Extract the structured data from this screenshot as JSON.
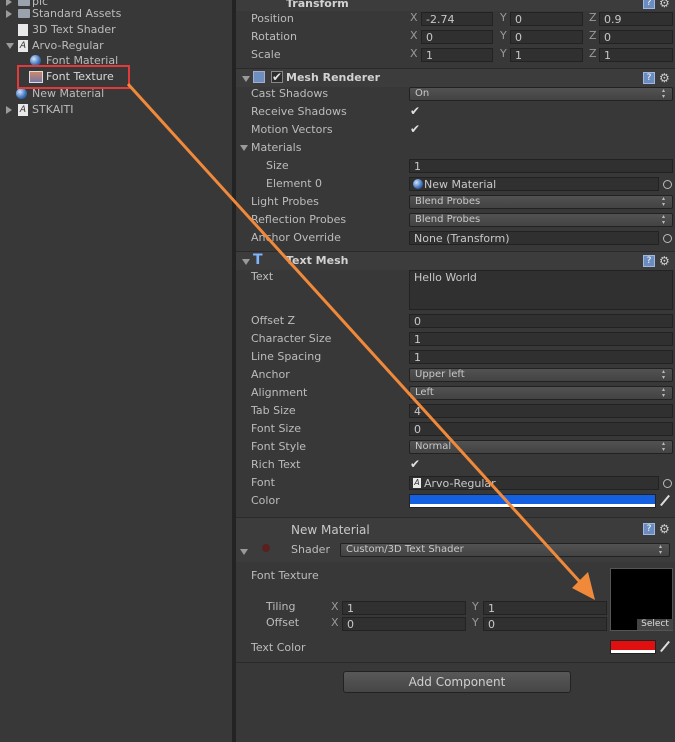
{
  "project": {
    "items": [
      {
        "label": "pic",
        "kind": "folder"
      },
      {
        "label": "Standard Assets",
        "kind": "folder"
      },
      {
        "label": "3D Text Shader",
        "kind": "shader"
      },
      {
        "label": "Arvo-Regular",
        "kind": "font"
      },
      {
        "label": "Font Material",
        "kind": "material"
      },
      {
        "label": "Font Texture",
        "kind": "texture"
      },
      {
        "label": "New Material",
        "kind": "material"
      },
      {
        "label": "STKAITI",
        "kind": "font"
      }
    ]
  },
  "transform": {
    "title": "Transform",
    "position": {
      "label": "Position",
      "x": "-2.74",
      "y": "0",
      "z": "0.9"
    },
    "rotation": {
      "label": "Rotation",
      "x": "0",
      "y": "0",
      "z": "0"
    },
    "scale": {
      "label": "Scale",
      "x": "1",
      "y": "1",
      "z": "1"
    },
    "axis": {
      "x": "X",
      "y": "Y",
      "z": "Z"
    }
  },
  "mesh_renderer": {
    "title": "Mesh Renderer",
    "cast_shadows": {
      "label": "Cast Shadows",
      "value": "On"
    },
    "receive_shadows": {
      "label": "Receive Shadows",
      "checked": true
    },
    "motion_vectors": {
      "label": "Motion Vectors",
      "checked": true
    },
    "materials": {
      "label": "Materials",
      "size_label": "Size",
      "size": "1",
      "element0_label": "Element 0",
      "element0": "New Material"
    },
    "light_probes": {
      "label": "Light Probes",
      "value": "Blend Probes"
    },
    "reflection_probes": {
      "label": "Reflection Probes",
      "value": "Blend Probes"
    },
    "anchor_override": {
      "label": "Anchor Override",
      "value": "None (Transform)"
    }
  },
  "text_mesh": {
    "title": "Text Mesh",
    "text": {
      "label": "Text",
      "value": "Hello World"
    },
    "offset_z": {
      "label": "Offset Z",
      "value": "0"
    },
    "character_size": {
      "label": "Character Size",
      "value": "1"
    },
    "line_spacing": {
      "label": "Line Spacing",
      "value": "1"
    },
    "anchor": {
      "label": "Anchor",
      "value": "Upper left"
    },
    "alignment": {
      "label": "Alignment",
      "value": "Left"
    },
    "tab_size": {
      "label": "Tab Size",
      "value": "4"
    },
    "font_size": {
      "label": "Font Size",
      "value": "0"
    },
    "font_style": {
      "label": "Font Style",
      "value": "Normal"
    },
    "rich_text": {
      "label": "Rich Text",
      "checked": true
    },
    "font": {
      "label": "Font",
      "value": "Arvo-Regular"
    },
    "color": {
      "label": "Color",
      "value": "#1560e0"
    }
  },
  "material": {
    "name": "New Material",
    "shader_label": "Shader",
    "shader": "Custom/3D Text Shader",
    "font_texture_label": "Font Texture",
    "tiling": {
      "label": "Tiling",
      "x": "1",
      "y": "1"
    },
    "offset": {
      "label": "Offset",
      "x": "0",
      "y": "0"
    },
    "select_label": "Select",
    "text_color": {
      "label": "Text Color",
      "value": "#e01010"
    }
  },
  "add_component_label": "Add Component",
  "colors": {
    "highlight": "#e03a3a",
    "arrow": "#f08a3a"
  }
}
